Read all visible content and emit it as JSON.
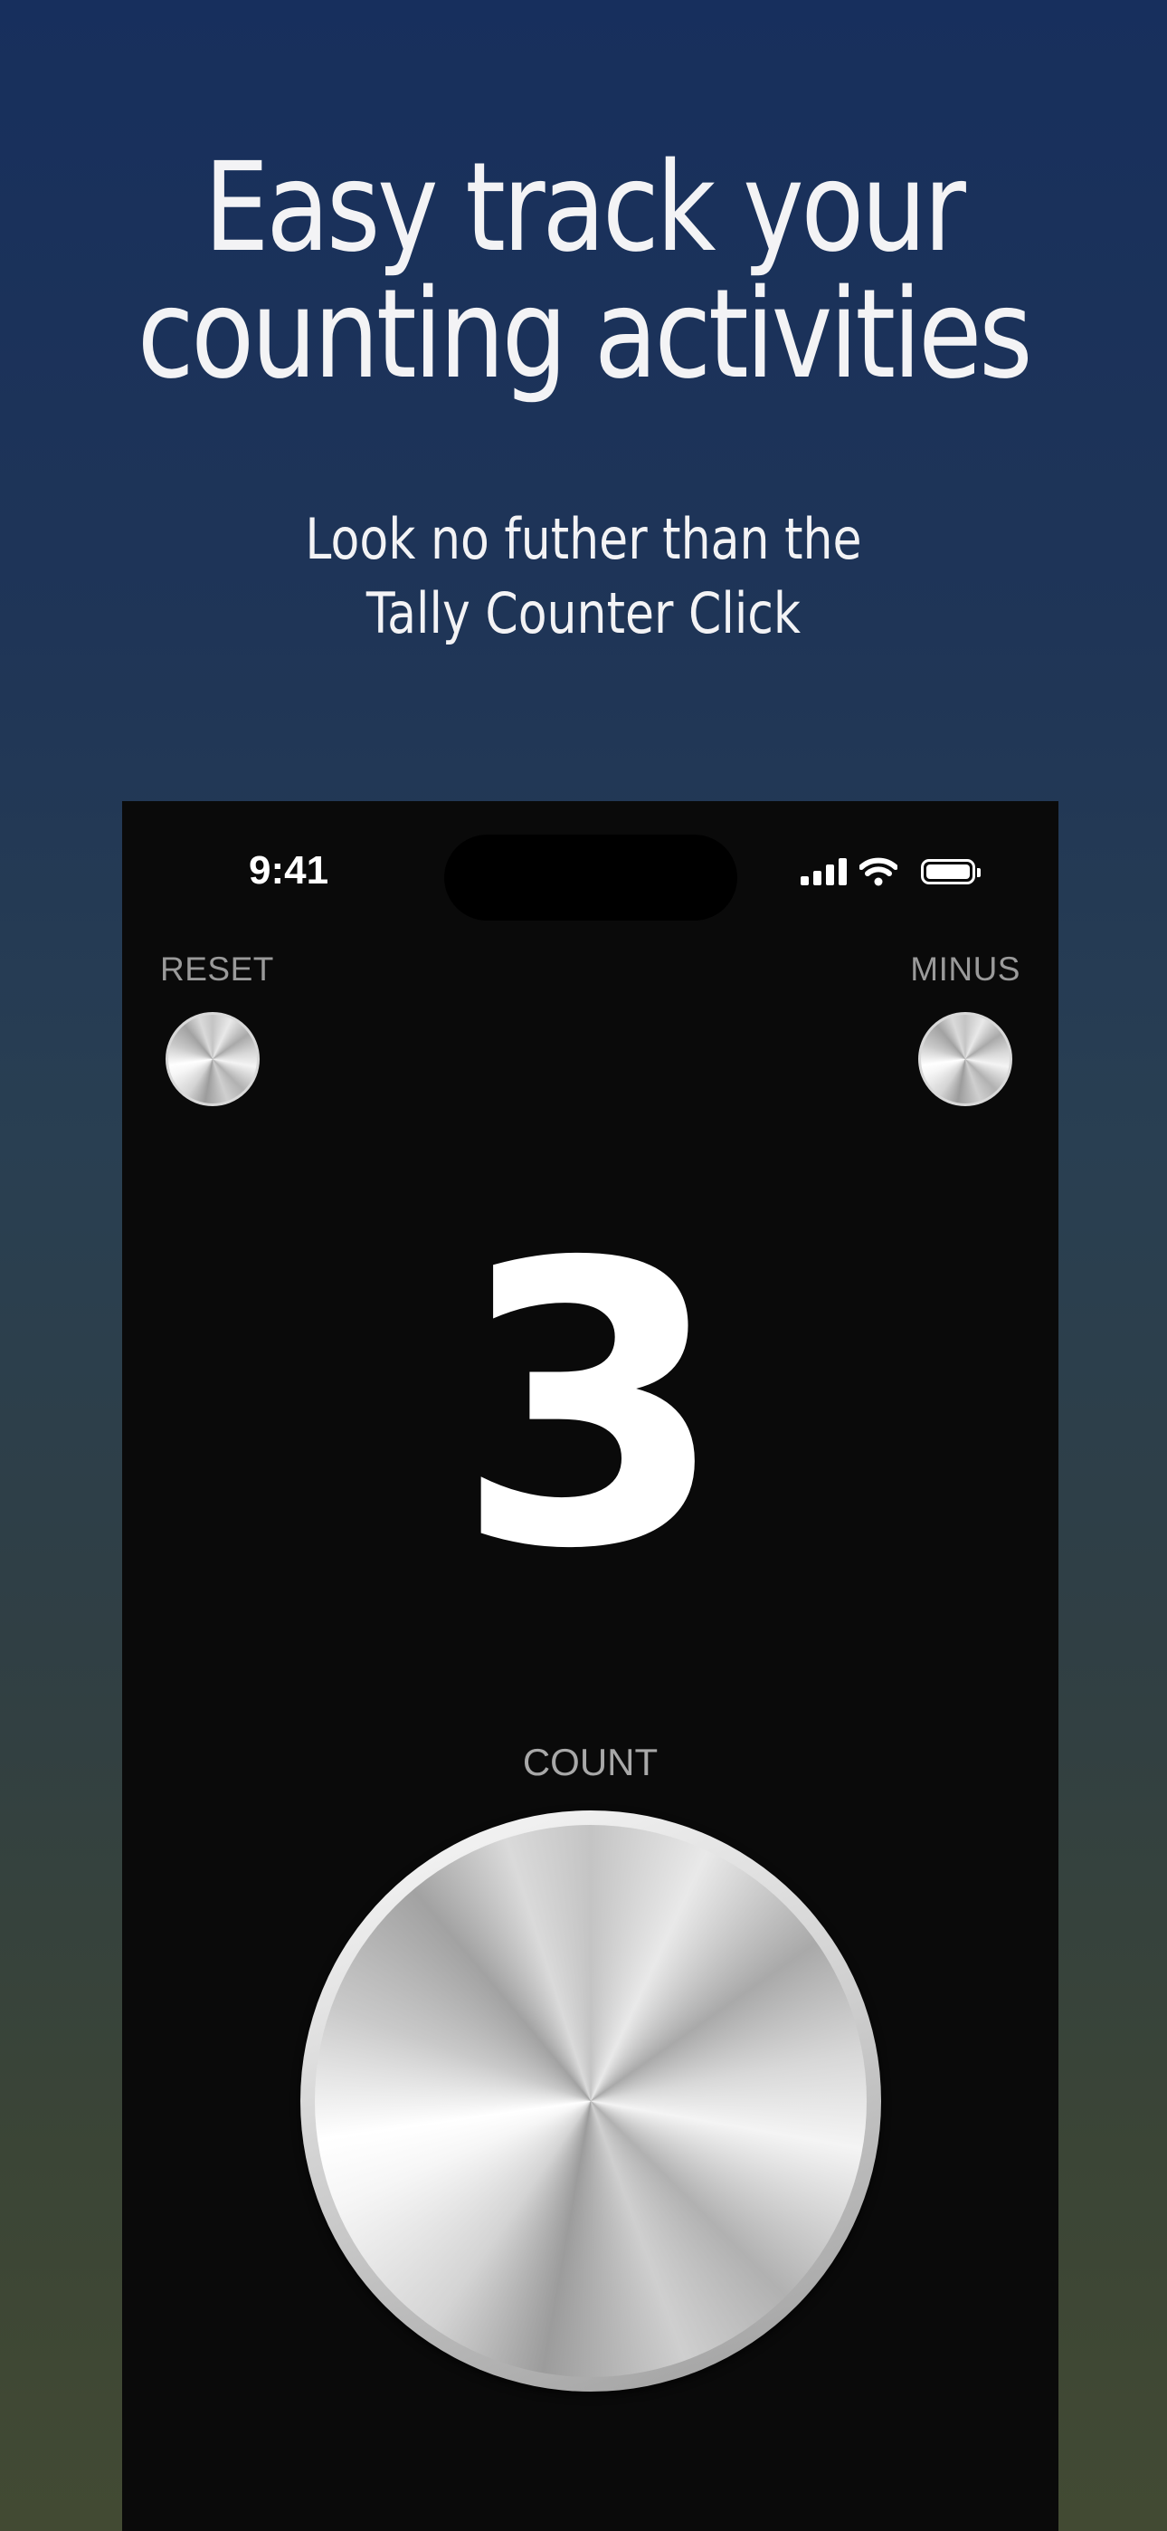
{
  "headline": {
    "line1": "Easy track your",
    "line2": "counting activities"
  },
  "subheadline": {
    "line1": "Look no futher than the",
    "line2": "Tally Counter Click"
  },
  "status_bar": {
    "time": "9:41",
    "icons": [
      "cellular-signal-icon",
      "wifi-icon",
      "battery-icon"
    ]
  },
  "counter": {
    "reset_label": "RESET",
    "minus_label": "MINUS",
    "value": "3",
    "count_label": "COUNT"
  },
  "colors": {
    "background_top": "#172f5d",
    "background_bottom": "#424a33",
    "screen": "#0a0a0a",
    "text": "#f3f3f5",
    "button_label": "#9a9a9a"
  }
}
